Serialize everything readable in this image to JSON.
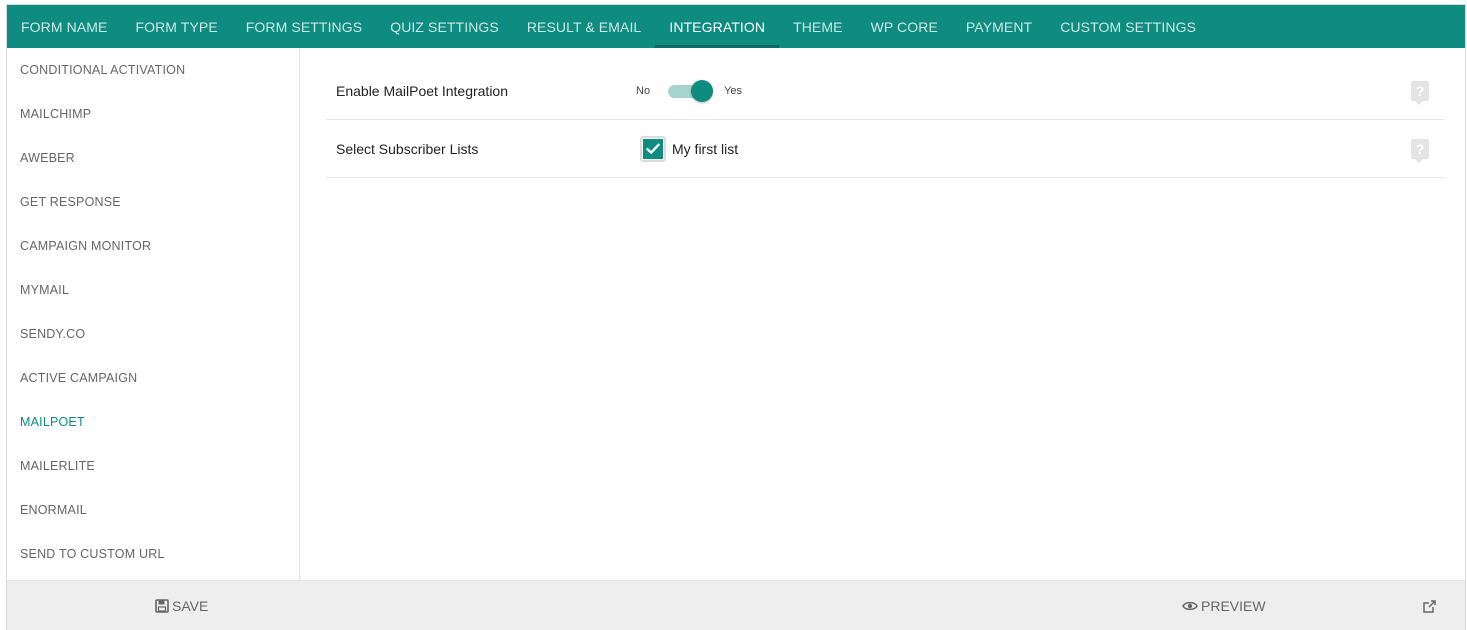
{
  "tabs": [
    {
      "label": "FORM NAME"
    },
    {
      "label": "FORM TYPE"
    },
    {
      "label": "FORM SETTINGS"
    },
    {
      "label": "QUIZ SETTINGS"
    },
    {
      "label": "RESULT & EMAIL"
    },
    {
      "label": "INTEGRATION"
    },
    {
      "label": "THEME"
    },
    {
      "label": "WP CORE"
    },
    {
      "label": "PAYMENT"
    },
    {
      "label": "CUSTOM SETTINGS"
    }
  ],
  "active_tab": "INTEGRATION",
  "sidebar": {
    "items": [
      {
        "label": "CONDITIONAL ACTIVATION"
      },
      {
        "label": "MAILCHIMP"
      },
      {
        "label": "AWEBER"
      },
      {
        "label": "GET RESPONSE"
      },
      {
        "label": "CAMPAIGN MONITOR"
      },
      {
        "label": "MYMAIL"
      },
      {
        "label": "SENDY.CO"
      },
      {
        "label": "ACTIVE CAMPAIGN"
      },
      {
        "label": "MAILPOET"
      },
      {
        "label": "MAILERLITE"
      },
      {
        "label": "ENORMAIL"
      },
      {
        "label": "SEND TO CUSTOM URL"
      }
    ],
    "active_item": "MAILPOET"
  },
  "settings": {
    "enable": {
      "label": "Enable MailPoet Integration",
      "off_label": "No",
      "on_label": "Yes",
      "value": true
    },
    "lists": {
      "label": "Select Subscriber Lists",
      "option_label": "My first list",
      "checked": true
    },
    "help_icon": "?"
  },
  "footer": {
    "save_label": "SAVE",
    "preview_label": "PREVIEW"
  },
  "colors": {
    "accent": "#0e8c80",
    "accent_light": "#a6d4cf",
    "footer_bg": "#eeeeee"
  }
}
